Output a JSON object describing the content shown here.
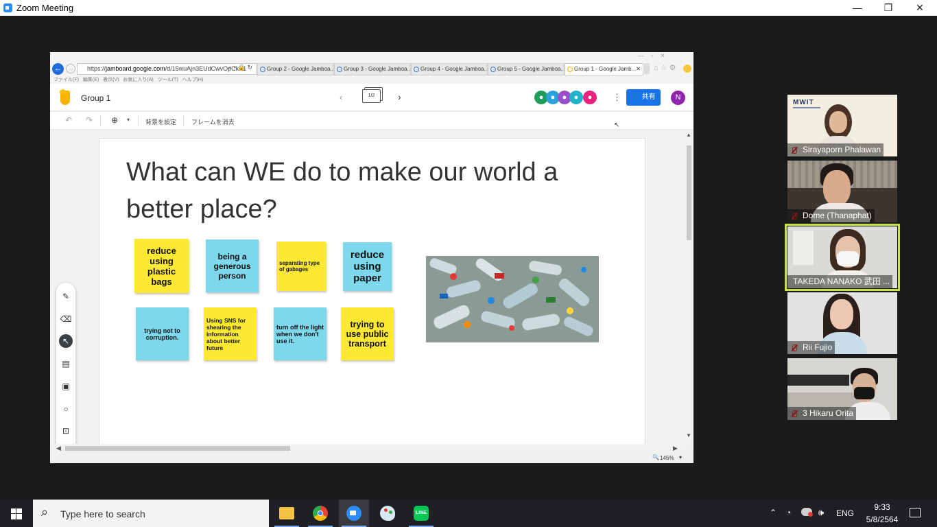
{
  "window": {
    "title": "Zoom Meeting",
    "min": "—",
    "restore": "❐",
    "close": "✕"
  },
  "browser": {
    "url_prefix": "https://",
    "url_domain": "jamboard.google.com",
    "url_rest": "/d/15wuAjn3EUdCwvOpCkX1",
    "tabs": [
      "Group 2 - Google Jamboa...",
      "Group 3 - Google Jamboa...",
      "Group 4 - Google Jamboa...",
      "Group 5 - Google Jamboa...",
      "Group 1 - Google Jamb..."
    ],
    "menu": "ファイル(F) 編集(E) 表示(V) お気に入り(A) ツール(T) ヘルプ(H)",
    "zoom_level": "145%"
  },
  "jamboard": {
    "doc_title": "Group 1",
    "frame_counter": "1/2",
    "share_label": "共有",
    "avatar_letter": "N",
    "toolbar": {
      "set_background": "背景を設定",
      "clear_frame": "フレームを消去"
    },
    "board_title": "What can WE do to make our world a better place?",
    "notes": [
      "reduce using plastic bags",
      "being a generous person",
      "separating type of gabages",
      "reduce using paper",
      "trying not to corruption.",
      "Using SNS for shearing the information about better future",
      "turn off the light when we don't use it.",
      "trying to use public transport"
    ]
  },
  "participants": [
    {
      "name": "Sirayaporn Phalawan",
      "logo": "MWIT"
    },
    {
      "name": "Dome (Thanaphat)"
    },
    {
      "name": "TAKEDA NANAKO 武田 ..."
    },
    {
      "name": "Rii Fujio"
    },
    {
      "name": "3 Hikaru Orita"
    }
  ],
  "taskbar": {
    "search_placeholder": "Type here to search",
    "lang": "ENG",
    "time": "9:33",
    "date": "5/8/2564"
  },
  "colors": {
    "zoom_blue": "#2d8cff",
    "note_yellow": "#fde933",
    "note_blue": "#7dd8ec",
    "active_speaker": "#c7e348",
    "share_blue": "#1a73e8"
  }
}
